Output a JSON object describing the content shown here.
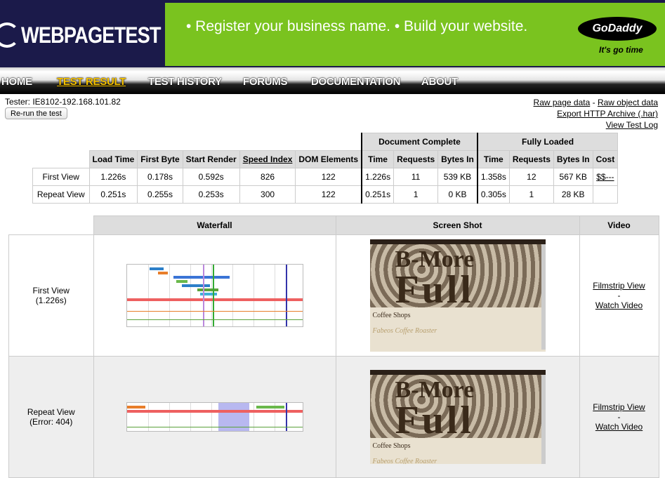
{
  "header": {
    "logo_text": "WEBPAGETEST",
    "ad_text": "• Register your business name.  • Build your website.",
    "ad_brand": "GoDaddy",
    "ad_tagline": "It's go time"
  },
  "nav": {
    "items": [
      {
        "label": "HOME"
      },
      {
        "label": "TEST RESULT",
        "active": true
      },
      {
        "label": "TEST HISTORY"
      },
      {
        "label": "FORUMS"
      },
      {
        "label": "DOCUMENTATION"
      },
      {
        "label": "ABOUT"
      }
    ]
  },
  "tester": {
    "label": "Tester: IE8102-192.168.101.82",
    "rerun_button": "Re-run the test"
  },
  "links": {
    "raw_page": "Raw page data",
    "separator": " - ",
    "raw_object": "Raw object data",
    "export_har": "Export HTTP Archive (.har)",
    "view_log": "View Test Log"
  },
  "results": {
    "group_headers": {
      "document_complete": "Document Complete",
      "fully_loaded": "Fully Loaded"
    },
    "columns": [
      "Load Time",
      "First Byte",
      "Start Render",
      "Speed Index",
      "DOM Elements",
      "Time",
      "Requests",
      "Bytes In",
      "Time",
      "Requests",
      "Bytes In",
      "Cost"
    ],
    "rows": [
      {
        "label": "First View",
        "cells": [
          "1.226s",
          "0.178s",
          "0.592s",
          "826",
          "122",
          "1.226s",
          "11",
          "539 KB",
          "1.358s",
          "12",
          "567 KB",
          "$$---"
        ]
      },
      {
        "label": "Repeat View",
        "cells": [
          "0.251s",
          "0.255s",
          "0.253s",
          "300",
          "122",
          "0.251s",
          "1",
          "0 KB",
          "0.305s",
          "1",
          "28 KB",
          ""
        ]
      }
    ]
  },
  "grid": {
    "headers": {
      "waterfall": "Waterfall",
      "screenshot": "Screen Shot",
      "video": "Video"
    },
    "rows": [
      {
        "label_line1": "First View",
        "label_line2": "(1.226s)",
        "filmstrip": "Filmstrip View",
        "dash": "-",
        "watch": "Watch Video",
        "shot_title1": "B-More",
        "shot_title2": "Full",
        "shot_line1": "Coffee Shops",
        "shot_line2": "Fabeos Coffee Roaster"
      },
      {
        "label_line1": "Repeat View",
        "label_line2": "(Error: 404)",
        "filmstrip": "Filmstrip View",
        "dash": "-",
        "watch": "Watch Video",
        "shot_title1": "B-More",
        "shot_title2": "Full",
        "shot_line1": "Coffee Shops",
        "shot_line2": "Fabeos Coffee Roaster"
      }
    ]
  },
  "colors": {
    "header_bg": "#1b1a4a",
    "ad_bg": "#7ac31f",
    "nav_active": "#f9c400"
  }
}
